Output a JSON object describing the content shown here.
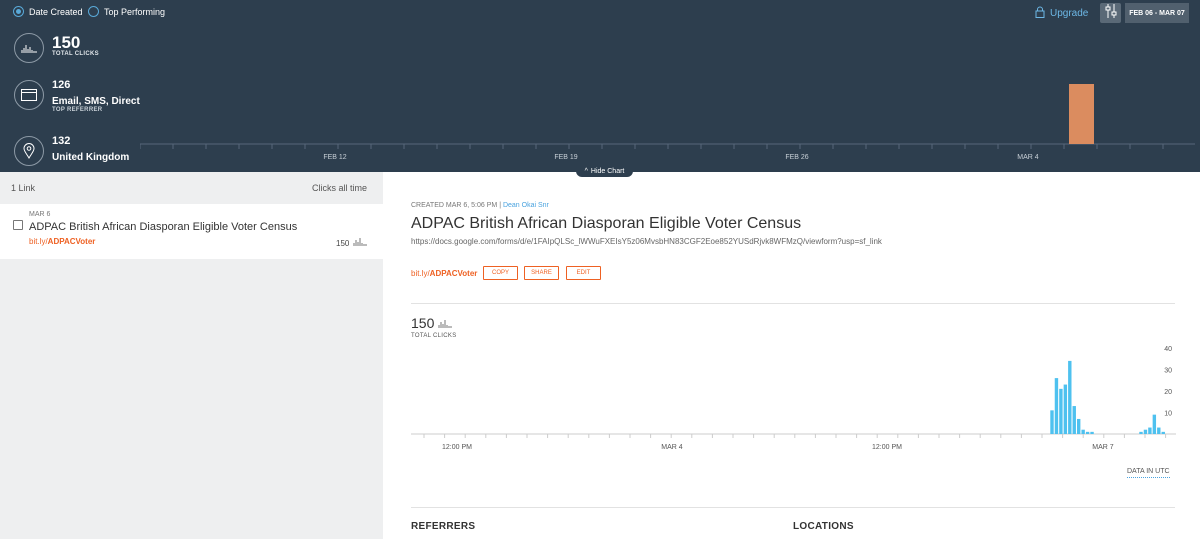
{
  "filters": {
    "sort_options": [
      {
        "label": "Date Created",
        "selected": true
      },
      {
        "label": "Top Performing",
        "selected": false
      }
    ],
    "upgrade_label": "Upgrade",
    "date_range": "FEB 06 - MAR 07"
  },
  "summary": {
    "total_clicks": {
      "value": "150",
      "label": "TOTAL CLICKS"
    },
    "top_referrer": {
      "value": "126",
      "label": "Email, SMS, Direct",
      "sublabel": "TOP REFERRER"
    },
    "top_location": {
      "value": "132",
      "label": "United Kingdom"
    }
  },
  "hide_chart_label": "Hide Chart",
  "link_list": {
    "count_label": "1 Link",
    "sort_label": "Clicks all time",
    "items": [
      {
        "date": "MAR 6",
        "title": "ADPAC British African Diasporan Eligible Voter Census",
        "short_link_prefix": "bit.ly/",
        "short_link_path": "ADPACVoter",
        "clicks": "150"
      }
    ]
  },
  "detail": {
    "created": "CREATED MAR 6, 5:06 PM",
    "user": "Dean Okai Snr",
    "title": "ADPAC British African Diasporan Eligible Voter Census",
    "long_url": "https://docs.google.com/forms/d/e/1FAIpQLSc_lWWuFXEIsY5z06MvsbHN83CGF2Eoe852YUSdRjvk8WFMzQ/viewform?usp=sf_link",
    "short_link_prefix": "bit.ly/",
    "short_link_path": "ADPACVoter",
    "actions": {
      "copy": "COPY",
      "share": "SHARE",
      "edit": "EDIT"
    },
    "total_clicks": "150",
    "total_clicks_label": "TOTAL CLICKS",
    "data_tz_label": "DATA IN UTC",
    "sections": {
      "referrers": "REFERRERS",
      "locations": "LOCATIONS"
    }
  },
  "colors": {
    "top_bg": "#2d3e4e",
    "accent_orange": "#ee6123",
    "bar_orange": "#db8c5f",
    "bar_blue": "#4ec1ef",
    "link_blue": "#4aa3df"
  },
  "chart_data": [
    {
      "type": "bar",
      "x_labels": [
        "FEB 12",
        "FEB 19",
        "FEB 26",
        "MAR 4"
      ],
      "categories": [
        "FEB 06",
        "FEB 07",
        "FEB 08",
        "FEB 09",
        "FEB 10",
        "FEB 11",
        "FEB 12",
        "FEB 13",
        "FEB 14",
        "FEB 15",
        "FEB 16",
        "FEB 17",
        "FEB 18",
        "FEB 19",
        "FEB 20",
        "FEB 21",
        "FEB 22",
        "FEB 23",
        "FEB 24",
        "FEB 25",
        "FEB 26",
        "FEB 27",
        "FEB 28",
        "MAR 1",
        "MAR 2",
        "MAR 3",
        "MAR 4",
        "MAR 5",
        "MAR 6",
        "MAR 7"
      ],
      "values": [
        0,
        0,
        0,
        0,
        0,
        0,
        0,
        0,
        0,
        0,
        0,
        0,
        0,
        0,
        0,
        0,
        0,
        0,
        0,
        0,
        0,
        0,
        0,
        0,
        0,
        0,
        0,
        0,
        150,
        0
      ],
      "grid": false
    },
    {
      "type": "bar",
      "x_labels": [
        "12:00 PM",
        "MAR 4",
        "12:00 PM",
        "MAR 7"
      ],
      "y_ticks": [
        10,
        20,
        30,
        40
      ],
      "ylim": [
        0,
        40
      ],
      "values": [
        0,
        0,
        0,
        0,
        0,
        0,
        0,
        0,
        0,
        0,
        0,
        0,
        0,
        0,
        0,
        0,
        0,
        0,
        0,
        0,
        0,
        0,
        0,
        0,
        0,
        0,
        0,
        0,
        0,
        0,
        0,
        0,
        0,
        0,
        0,
        0,
        0,
        0,
        0,
        0,
        0,
        0,
        0,
        0,
        0,
        0,
        0,
        0,
        0,
        0,
        0,
        0,
        0,
        0,
        0,
        0,
        0,
        0,
        0,
        0,
        0,
        0,
        0,
        0,
        0,
        0,
        0,
        0,
        0,
        0,
        0,
        0,
        0,
        0,
        0,
        0,
        0,
        0,
        0,
        0,
        0,
        0,
        0,
        0,
        0,
        0,
        0,
        0,
        0,
        0,
        0,
        0,
        0,
        0,
        0,
        0,
        0,
        0,
        0,
        0,
        0,
        0,
        0,
        0,
        0,
        0,
        0,
        0,
        0,
        0,
        0,
        0,
        0,
        0,
        0,
        0,
        0,
        0,
        0,
        0,
        0,
        0,
        0,
        0,
        0,
        0,
        0,
        0,
        0,
        0,
        0,
        0,
        0,
        0,
        0,
        0,
        0,
        0,
        0,
        0,
        0,
        0,
        11,
        26,
        21,
        23,
        34,
        13,
        7,
        2,
        1,
        1,
        0,
        0,
        0,
        0,
        0,
        0,
        0,
        0,
        0,
        0,
        1,
        2,
        3,
        9,
        3,
        1
      ],
      "grid": false
    }
  ]
}
